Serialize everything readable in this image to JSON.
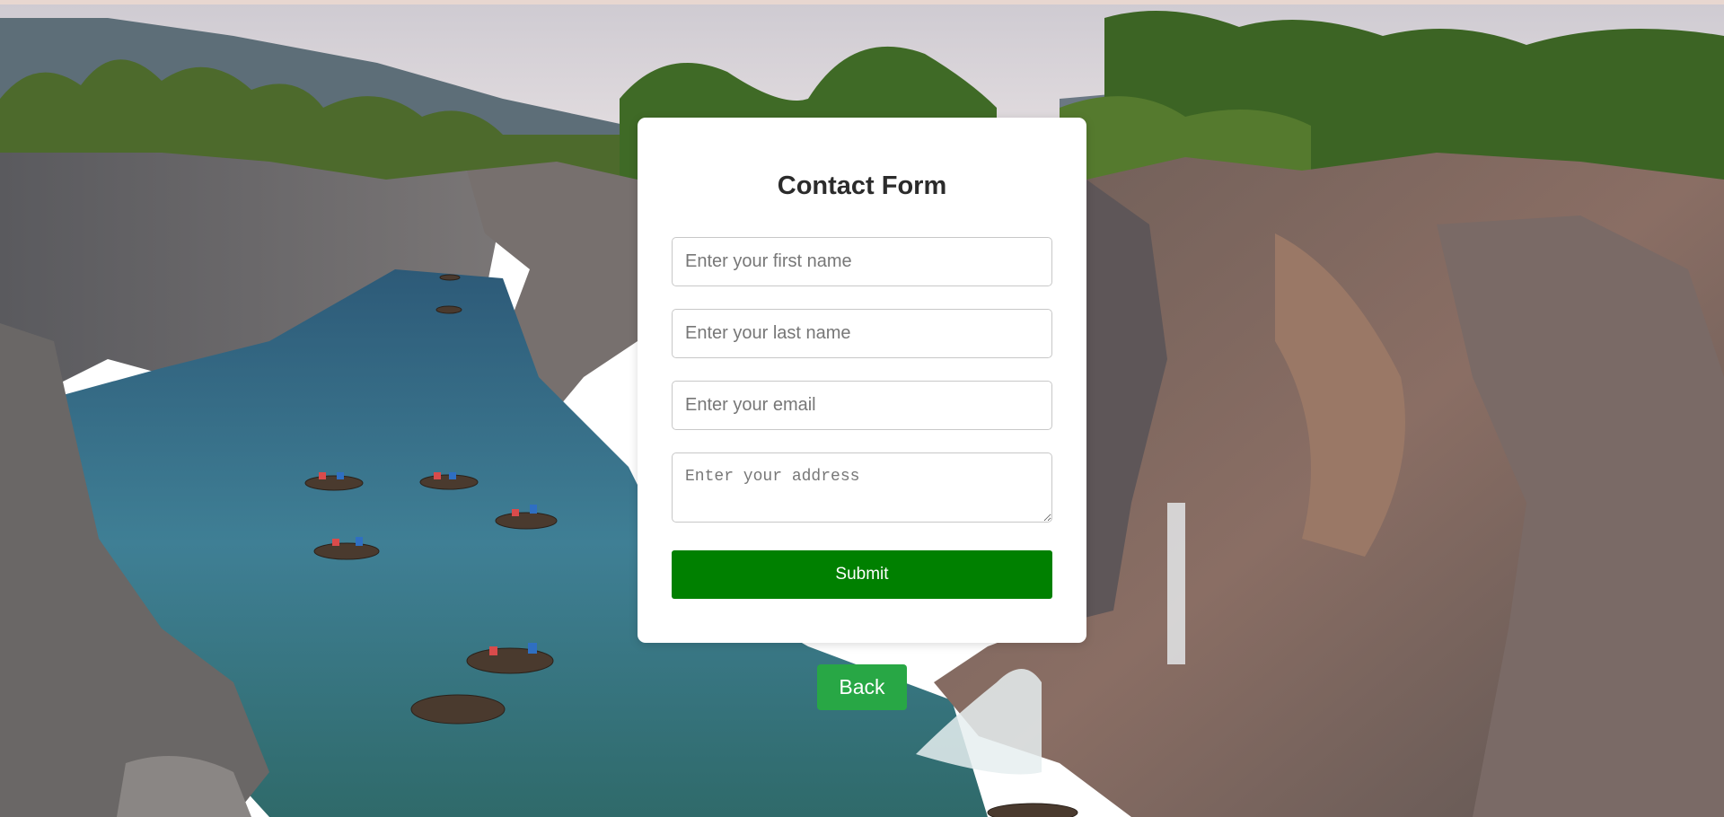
{
  "form": {
    "title": "Contact Form",
    "first_name_placeholder": "Enter your first name",
    "last_name_placeholder": "Enter your last name",
    "email_placeholder": "Enter your email",
    "address_placeholder": "Enter your address",
    "submit_label": "Submit"
  },
  "back_label": "Back",
  "colors": {
    "submit_button": "#008000",
    "back_button": "#28a745",
    "card_background": "#ffffff",
    "title_text": "#2b2b2b"
  }
}
